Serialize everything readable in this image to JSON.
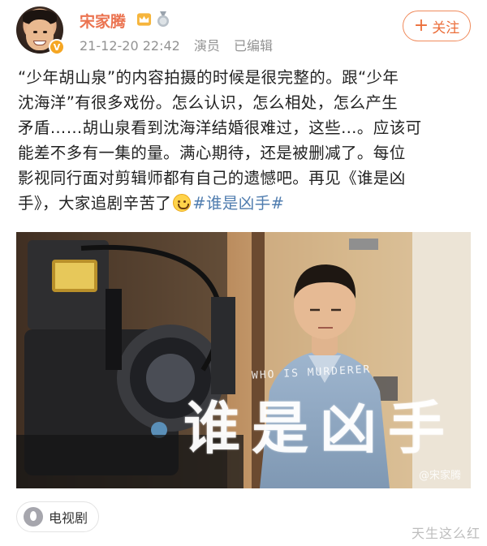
{
  "user": {
    "name": "宋家腾",
    "verified_badge": "V",
    "crown_icon": "crown-icon",
    "medal_icon": "medal-icon",
    "avatar_icon": "avatar"
  },
  "meta": {
    "timestamp": "21-12-20 22:42",
    "role": "演员",
    "edited": "已编辑"
  },
  "follow": {
    "plus": "+",
    "label": "关注"
  },
  "post": {
    "lines": [
      "“少年胡山泉”的内容拍摄的时候是很完整的。跟“少年",
      "沈海洋”有很多戏份。怎么认识，怎么相处，怎么产生",
      "矛盾……胡山泉看到沈海洋结婚很难过，这些…。应该可",
      "能差不多有一集的量。满心期待，还是被删减了。每位",
      "影视同行面对剪辑师都有自己的遗憾吧。再见《谁是凶"
    ],
    "last_line_text": "手》，大家追剧辛苦了",
    "emoji": "smile-emoji",
    "hashtag": "#谁是凶手#"
  },
  "photo": {
    "overlay_en": "WHO IS MURDERER",
    "overlay_cn": "谁是凶手",
    "watermark": "@宋家腾"
  },
  "tag": {
    "label": "电视剧",
    "icon": "flame-icon"
  },
  "site_watermark": "天生这么红",
  "colors": {
    "username": "#eb7350",
    "follow": "#eb6e3a",
    "hashtag": "#507daf",
    "meta": "#939393"
  }
}
